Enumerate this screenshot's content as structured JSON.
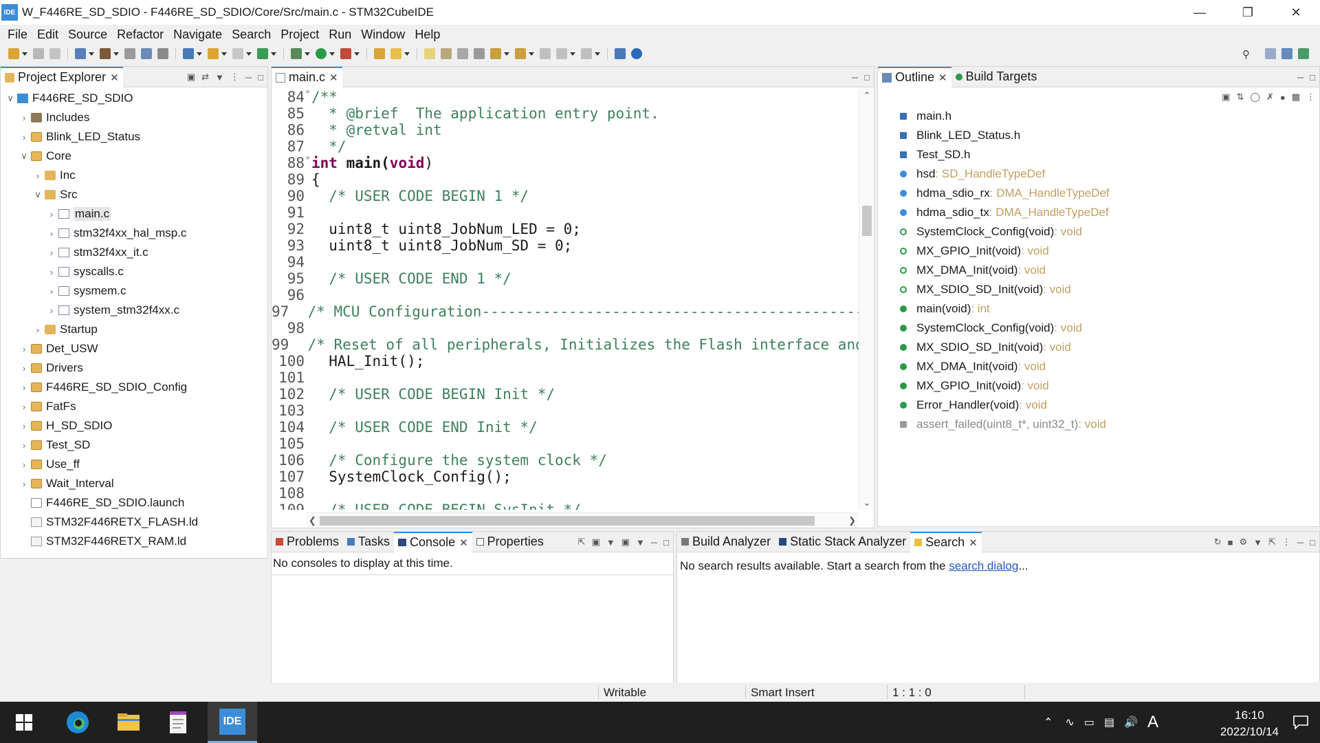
{
  "window": {
    "title": "W_F446RE_SD_SDIO - F446RE_SD_SDIO/Core/Src/main.c - STM32CubeIDE",
    "app_icon_text": "IDE",
    "buttons": [
      "minimize",
      "restore",
      "close"
    ]
  },
  "menu": [
    "File",
    "Edit",
    "Source",
    "Refactor",
    "Navigate",
    "Search",
    "Project",
    "Run",
    "Window",
    "Help"
  ],
  "explorer": {
    "tab_label": "Project Explorer",
    "tree": [
      {
        "label": "F446RE_SD_SDIO",
        "icon": "project-icon",
        "depth": 0,
        "arrow": "expanded"
      },
      {
        "label": "Includes",
        "icon": "includes-icon",
        "depth": 1,
        "arrow": "collapsed"
      },
      {
        "label": "Blink_LED_Status",
        "icon": "source-folder-icon",
        "depth": 1,
        "arrow": "collapsed"
      },
      {
        "label": "Core",
        "icon": "source-folder-icon",
        "depth": 1,
        "arrow": "expanded"
      },
      {
        "label": "Inc",
        "icon": "folder-icon",
        "depth": 2,
        "arrow": "collapsed"
      },
      {
        "label": "Src",
        "icon": "folder-icon",
        "depth": 2,
        "arrow": "expanded"
      },
      {
        "label": "main.c",
        "icon": "c-file-icon",
        "depth": 3,
        "arrow": "collapsed",
        "selected": true
      },
      {
        "label": "stm32f4xx_hal_msp.c",
        "icon": "c-file-icon",
        "depth": 3,
        "arrow": "collapsed"
      },
      {
        "label": "stm32f4xx_it.c",
        "icon": "c-file-icon",
        "depth": 3,
        "arrow": "collapsed"
      },
      {
        "label": "syscalls.c",
        "icon": "c-file-icon",
        "depth": 3,
        "arrow": "collapsed"
      },
      {
        "label": "sysmem.c",
        "icon": "c-file-icon",
        "depth": 3,
        "arrow": "collapsed"
      },
      {
        "label": "system_stm32f4xx.c",
        "icon": "c-file-icon",
        "depth": 3,
        "arrow": "collapsed"
      },
      {
        "label": "Startup",
        "icon": "folder-icon",
        "depth": 2,
        "arrow": "collapsed"
      },
      {
        "label": "Det_USW",
        "icon": "source-folder-icon",
        "depth": 1,
        "arrow": "collapsed"
      },
      {
        "label": "Drivers",
        "icon": "source-folder-icon",
        "depth": 1,
        "arrow": "collapsed"
      },
      {
        "label": "F446RE_SD_SDIO_Config",
        "icon": "source-folder-icon",
        "depth": 1,
        "arrow": "collapsed"
      },
      {
        "label": "FatFs",
        "icon": "source-folder-icon",
        "depth": 1,
        "arrow": "collapsed"
      },
      {
        "label": "H_SD_SDIO",
        "icon": "source-folder-icon",
        "depth": 1,
        "arrow": "collapsed"
      },
      {
        "label": "Test_SD",
        "icon": "source-folder-icon",
        "depth": 1,
        "arrow": "collapsed"
      },
      {
        "label": "Use_ff",
        "icon": "source-folder-icon",
        "depth": 1,
        "arrow": "collapsed"
      },
      {
        "label": "Wait_Interval",
        "icon": "source-folder-icon",
        "depth": 1,
        "arrow": "collapsed"
      },
      {
        "label": "F446RE_SD_SDIO.launch",
        "icon": "launch-file-icon",
        "depth": 1,
        "arrow": "none"
      },
      {
        "label": "STM32F446RETX_FLASH.ld",
        "icon": "ld-file-icon",
        "depth": 1,
        "arrow": "none"
      },
      {
        "label": "STM32F446RETX_RAM.ld",
        "icon": "ld-file-icon",
        "depth": 1,
        "arrow": "none"
      }
    ]
  },
  "editor": {
    "tab_label": "main.c",
    "lines": [
      {
        "n": "84",
        "text": "/**",
        "kind": "comment",
        "fold": true
      },
      {
        "n": "85",
        "text": "  * @brief  The application entry point.",
        "kind": "comment"
      },
      {
        "n": "86",
        "text": "  * @retval int",
        "kind": "comment"
      },
      {
        "n": "87",
        "text": "  */",
        "kind": "comment"
      },
      {
        "n": "88",
        "text": "int main(void)",
        "kind": "signature",
        "fold": true
      },
      {
        "n": "89",
        "text": "{",
        "kind": "code"
      },
      {
        "n": "90",
        "text": "  /* USER CODE BEGIN 1 */",
        "kind": "comment"
      },
      {
        "n": "91",
        "text": "",
        "kind": "code"
      },
      {
        "n": "92",
        "text": "  uint8_t uint8_JobNum_LED = 0;",
        "kind": "code"
      },
      {
        "n": "93",
        "text": "  uint8_t uint8_JobNum_SD = 0;",
        "kind": "code"
      },
      {
        "n": "94",
        "text": "",
        "kind": "code"
      },
      {
        "n": "95",
        "text": "  /* USER CODE END 1 */",
        "kind": "comment"
      },
      {
        "n": "96",
        "text": "",
        "kind": "code"
      },
      {
        "n": "97",
        "text": "  /* MCU Configuration--------------------------------------------------------*/",
        "kind": "comment"
      },
      {
        "n": "98",
        "text": "",
        "kind": "code"
      },
      {
        "n": "99",
        "text": "  /* Reset of all peripherals, Initializes the Flash interface and the Systick. *",
        "kind": "comment"
      },
      {
        "n": "100",
        "text": "  HAL_Init();",
        "kind": "code"
      },
      {
        "n": "101",
        "text": "",
        "kind": "code"
      },
      {
        "n": "102",
        "text": "  /* USER CODE BEGIN Init */",
        "kind": "comment"
      },
      {
        "n": "103",
        "text": "",
        "kind": "code"
      },
      {
        "n": "104",
        "text": "  /* USER CODE END Init */",
        "kind": "comment"
      },
      {
        "n": "105",
        "text": "",
        "kind": "code"
      },
      {
        "n": "106",
        "text": "  /* Configure the system clock */",
        "kind": "comment"
      },
      {
        "n": "107",
        "text": "  SystemClock_Config();",
        "kind": "code"
      },
      {
        "n": "108",
        "text": "",
        "kind": "code"
      },
      {
        "n": "109",
        "text": "  /* USER CODE BEGIN SysInit */",
        "kind": "comment"
      }
    ]
  },
  "outline": {
    "tabs": [
      "Outline",
      "Build Targets"
    ],
    "items": [
      {
        "label": "main.h",
        "type": "",
        "icon": "header-icon"
      },
      {
        "label": "Blink_LED_Status.h",
        "type": "",
        "icon": "header-icon"
      },
      {
        "label": "Test_SD.h",
        "type": "",
        "icon": "header-icon"
      },
      {
        "label": "hsd",
        "type": " : SD_HandleTypeDef",
        "icon": "variable-icon"
      },
      {
        "label": "hdma_sdio_rx",
        "type": " : DMA_HandleTypeDef",
        "icon": "variable-icon"
      },
      {
        "label": "hdma_sdio_tx",
        "type": " : DMA_HandleTypeDef",
        "icon": "variable-icon"
      },
      {
        "label": "SystemClock_Config(void)",
        "type": " : void",
        "icon": "declaration-icon"
      },
      {
        "label": "MX_GPIO_Init(void)",
        "type": " : void",
        "icon": "declaration-icon"
      },
      {
        "label": "MX_DMA_Init(void)",
        "type": " : void",
        "icon": "declaration-icon"
      },
      {
        "label": "MX_SDIO_SD_Init(void)",
        "type": " : void",
        "icon": "declaration-icon"
      },
      {
        "label": "main(void)",
        "type": " : int",
        "icon": "function-icon"
      },
      {
        "label": "SystemClock_Config(void)",
        "type": " : void",
        "icon": "function-icon"
      },
      {
        "label": "MX_SDIO_SD_Init(void)",
        "type": " : void",
        "icon": "function-icon"
      },
      {
        "label": "MX_DMA_Init(void)",
        "type": " : void",
        "icon": "function-icon"
      },
      {
        "label": "MX_GPIO_Init(void)",
        "type": " : void",
        "icon": "function-icon"
      },
      {
        "label": "Error_Handler(void)",
        "type": " : void",
        "icon": "function-icon"
      },
      {
        "label": "assert_failed(uint8_t*, uint32_t)",
        "type": " : void",
        "icon": "assert-icon",
        "dim": true
      }
    ]
  },
  "console": {
    "tabs": [
      "Problems",
      "Tasks",
      "Console",
      "Properties"
    ],
    "message": "No consoles to display at this time."
  },
  "search": {
    "tabs": [
      "Build Analyzer",
      "Static Stack Analyzer",
      "Search"
    ],
    "message_prefix": "No search results available. Start a search from the ",
    "link_text": "search dialog",
    "message_suffix": "..."
  },
  "status": {
    "writable": "Writable",
    "insert_mode": "Smart Insert",
    "position": "1 : 1 : 0"
  },
  "taskbar": {
    "time": "16:10",
    "date": "2022/10/14",
    "ime": "A",
    "ide_label": "IDE"
  },
  "colors": {
    "accent": "#3c8dd8",
    "comment": "#3f7f5f",
    "keyword": "#7f0055",
    "type_hint": "#c0a060",
    "link": "#2255bb"
  }
}
